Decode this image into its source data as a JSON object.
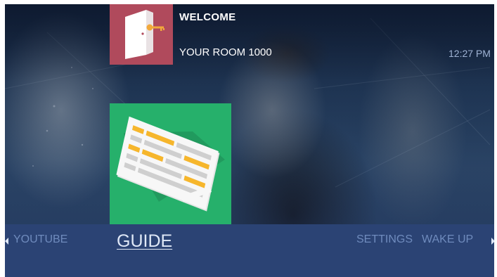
{
  "header": {
    "welcome_title": "WELCOME",
    "room_label": "YOUR ROOM 1000",
    "clock": "12:27 PM"
  },
  "tiles": {
    "welcome_icon": "door-key-icon",
    "welcome_color": "#b04a5c",
    "guide_icon": "guide-list-icon",
    "guide_color": "#26b06b"
  },
  "nav": {
    "items": [
      {
        "label": "YOUTUBE",
        "active": false
      },
      {
        "label": "GUIDE",
        "active": true
      },
      {
        "label": "SETTINGS",
        "active": false
      },
      {
        "label": "WAKE UP",
        "active": false
      }
    ],
    "bar_color": "#2b4374",
    "left_arrow_icon": "arrow-left-icon",
    "right_arrow_icon": "arrow-right-icon"
  }
}
